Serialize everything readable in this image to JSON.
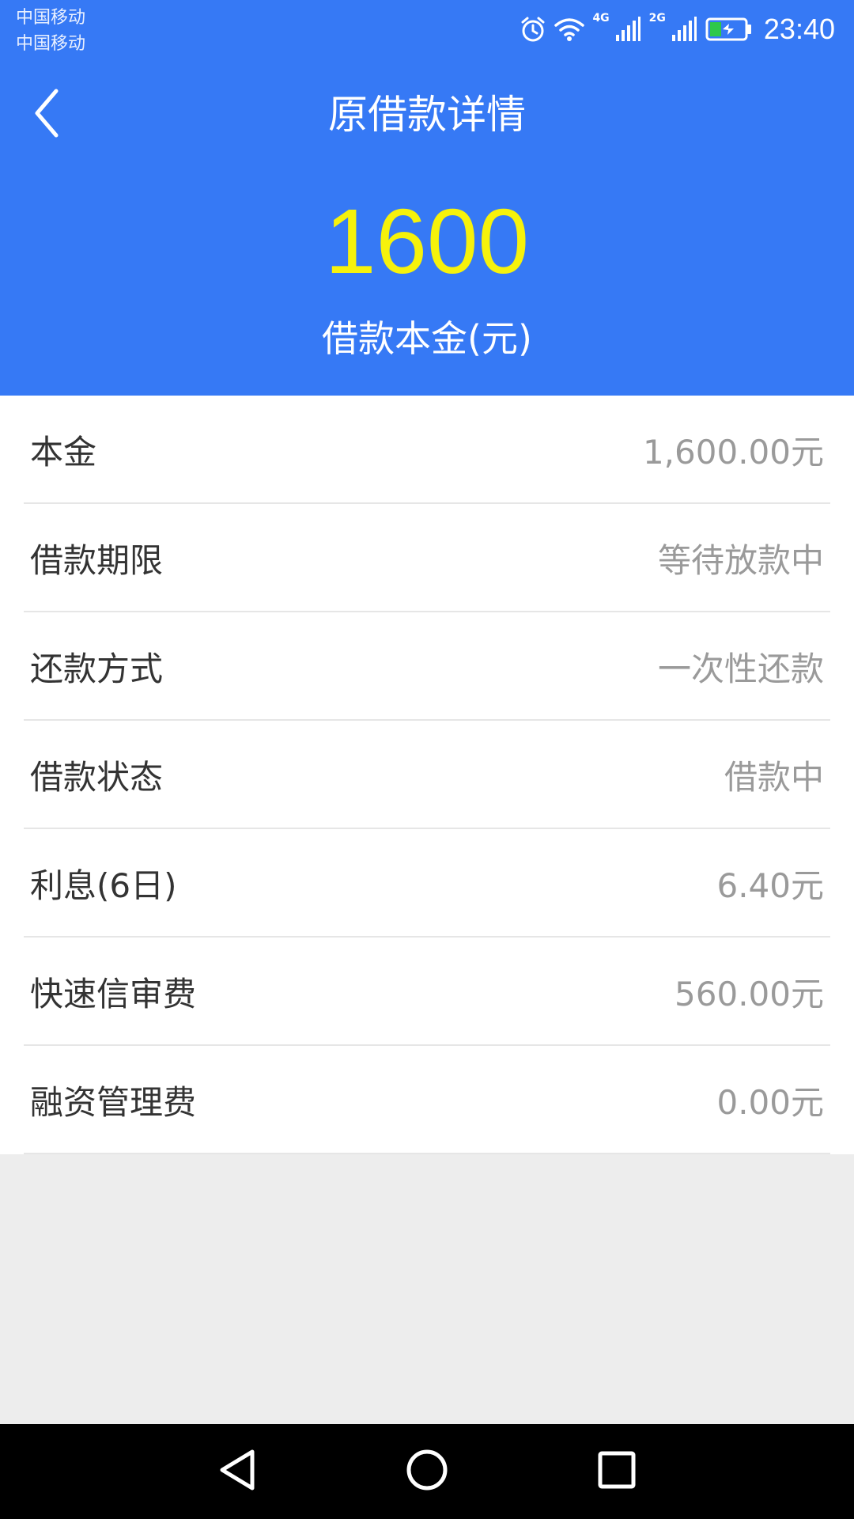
{
  "status_bar": {
    "carrier_1": "中国移动",
    "carrier_2": "中国移动",
    "network_1": "4G",
    "network_2": "2G",
    "time": "23:40",
    "icons": [
      "alarm-icon",
      "wifi-icon",
      "signal-icon",
      "signal-icon",
      "battery-charging-icon"
    ]
  },
  "header": {
    "back_icon": "chevron-left-icon",
    "title": "原借款详情",
    "amount": "1600",
    "amount_caption": "借款本金(元)"
  },
  "details": [
    {
      "label": "本金",
      "value": "1,600.00元"
    },
    {
      "label": "借款期限",
      "value": "等待放款中"
    },
    {
      "label": "还款方式",
      "value": "一次性还款"
    },
    {
      "label": "借款状态",
      "value": "借款中"
    },
    {
      "label": "利息(6日)",
      "value": "6.40元"
    },
    {
      "label": "快速信审费",
      "value": "560.00元"
    },
    {
      "label": "融资管理费",
      "value": "0.00元"
    }
  ],
  "system_nav": {
    "back": "triangle-back-icon",
    "home": "circle-home-icon",
    "recents": "square-recents-icon"
  },
  "colors": {
    "header_bg": "#3679f5",
    "amount": "#f6f20b",
    "page_bg": "#ededed"
  }
}
